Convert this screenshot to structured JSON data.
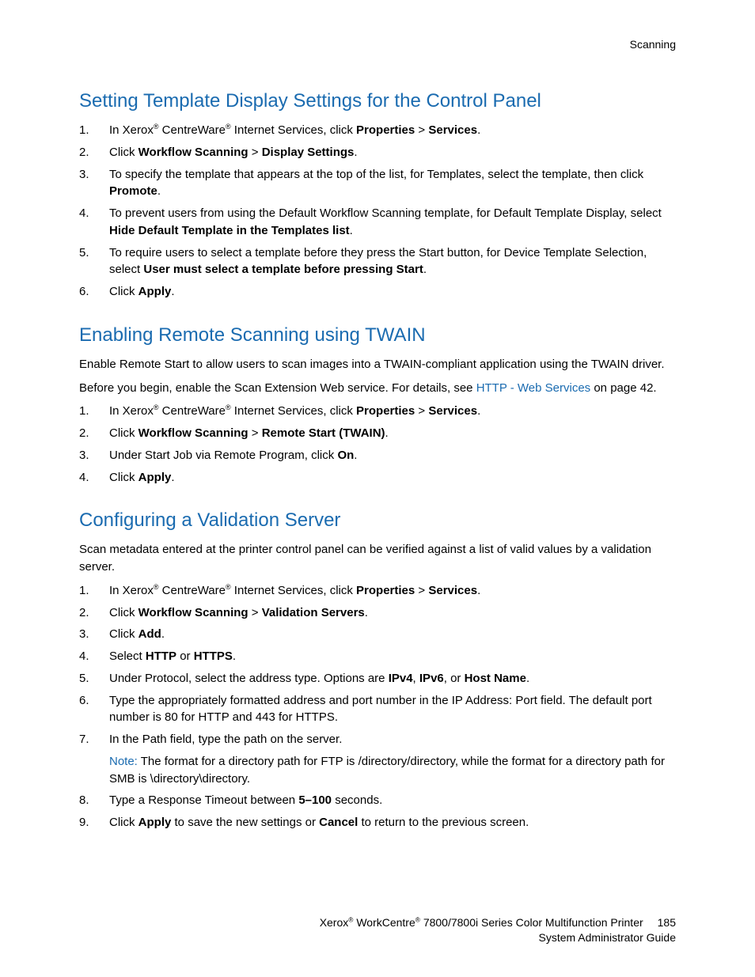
{
  "header": {
    "section": "Scanning"
  },
  "sec1": {
    "title": "Setting Template Display Settings for the Control Panel",
    "steps": {
      "s1a": "In Xerox",
      "s1b": " CentreWare",
      "s1c": " Internet Services, click ",
      "s1d": "Properties",
      "s1e": " > ",
      "s1f": "Services",
      "s1g": ".",
      "s2a": "Click ",
      "s2b": "Workflow Scanning",
      "s2c": " > ",
      "s2d": "Display Settings",
      "s2e": ".",
      "s3a": "To specify the template that appears at the top of the list, for Templates, select the template, then click ",
      "s3b": "Promote",
      "s3c": ".",
      "s4a": "To prevent users from using the Default Workflow Scanning template, for Default Template Display, select ",
      "s4b": "Hide Default Template in the Templates list",
      "s4c": ".",
      "s5a": "To require users to select a template before they press the Start button, for Device Template Selection, select ",
      "s5b": "User must select a template before pressing Start",
      "s5c": ".",
      "s6a": "Click ",
      "s6b": "Apply",
      "s6c": "."
    }
  },
  "sec2": {
    "title": "Enabling Remote Scanning using TWAIN",
    "intro": "Enable Remote Start to allow users to scan images into a TWAIN-compliant application using the TWAIN driver.",
    "before_a": "Before you begin, enable the Scan Extension Web service. For details, see ",
    "before_link": "HTTP - Web Services",
    "before_b": " on page 42.",
    "steps": {
      "s1a": "In Xerox",
      "s1b": " CentreWare",
      "s1c": " Internet Services, click ",
      "s1d": "Properties",
      "s1e": " > ",
      "s1f": "Services",
      "s1g": ".",
      "s2a": "Click ",
      "s2b": "Workflow Scanning",
      "s2c": " > ",
      "s2d": "Remote Start (TWAIN)",
      "s2e": ".",
      "s3a": "Under Start Job via Remote Program, click ",
      "s3b": "On",
      "s3c": ".",
      "s4a": "Click ",
      "s4b": "Apply",
      "s4c": "."
    }
  },
  "sec3": {
    "title": "Configuring a Validation Server",
    "intro": "Scan metadata entered at the printer control panel can be verified against a list of valid values by a validation server.",
    "steps": {
      "s1a": "In Xerox",
      "s1b": " CentreWare",
      "s1c": " Internet Services, click ",
      "s1d": "Properties",
      "s1e": " > ",
      "s1f": "Services",
      "s1g": ".",
      "s2a": "Click ",
      "s2b": "Workflow Scanning",
      "s2c": " > ",
      "s2d": "Validation Servers",
      "s2e": ".",
      "s3a": "Click ",
      "s3b": "Add",
      "s3c": ".",
      "s4a": "Select ",
      "s4b": "HTTP",
      "s4c": " or ",
      "s4d": "HTTPS",
      "s4e": ".",
      "s5a": "Under Protocol, select the address type. Options are ",
      "s5b": "IPv4",
      "s5c": ", ",
      "s5d": "IPv6",
      "s5e": ", or ",
      "s5f": "Host Name",
      "s5g": ".",
      "s6": "Type the appropriately formatted address and port number in the IP Address: Port field. The default port number is 80 for HTTP and 443 for HTTPS.",
      "s7": "In the Path field, type the path on the server.",
      "note_label": "Note:",
      "note_body": " The format for a directory path for FTP is /directory/directory, while the format for a directory path for SMB is \\directory\\directory.",
      "s8a": "Type a Response Timeout between ",
      "s8b": "5–100",
      "s8c": " seconds.",
      "s9a": "Click ",
      "s9b": "Apply",
      "s9c": " to save the new settings or ",
      "s9d": "Cancel",
      "s9e": " to return to the previous screen."
    }
  },
  "footer": {
    "line1a": "Xerox",
    "line1b": " WorkCentre",
    "line1c": " 7800/7800i Series Color Multifunction Printer",
    "line2": "System Administrator Guide",
    "page": "185"
  },
  "reg": "®"
}
